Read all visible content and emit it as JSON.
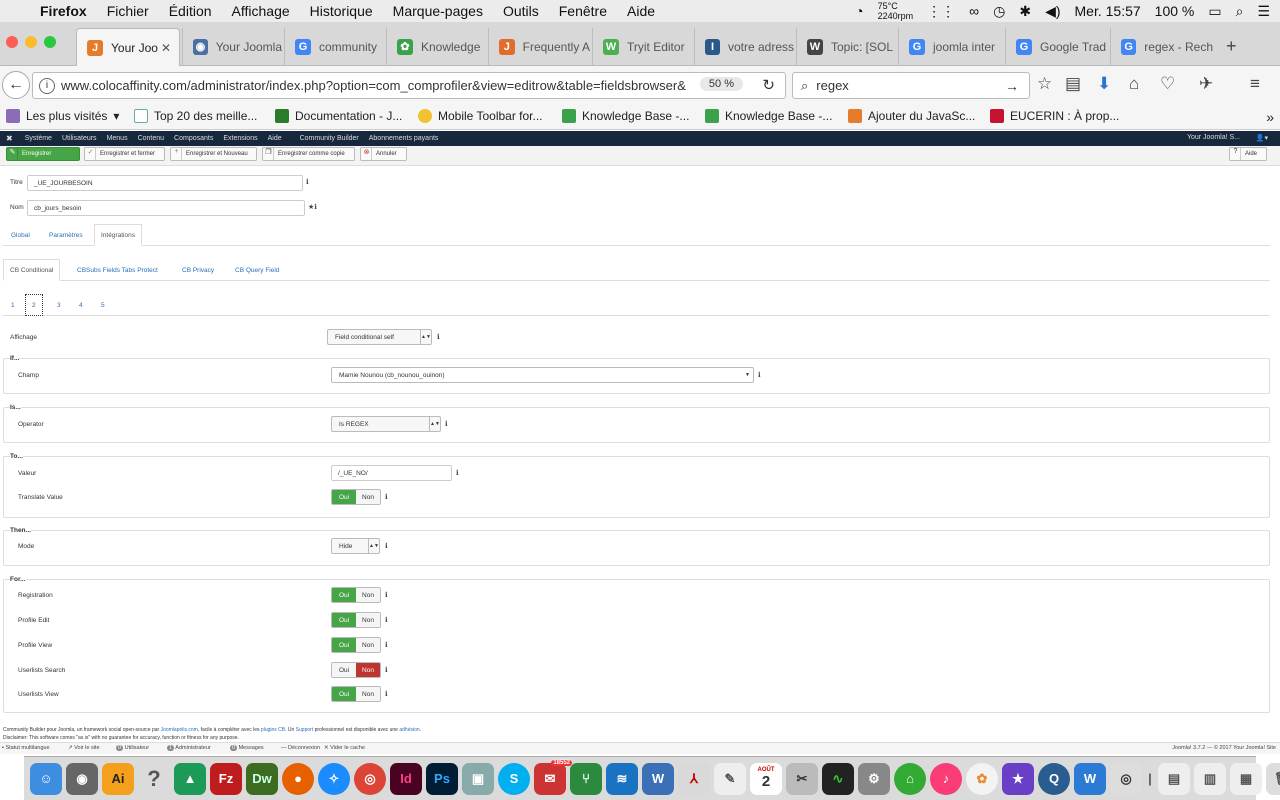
{
  "macbar": {
    "app": "Firefox",
    "menus": [
      "Fichier",
      "Édition",
      "Affichage",
      "Historique",
      "Marque-pages",
      "Outils",
      "Fenêtre",
      "Aide"
    ],
    "temp": "75°C",
    "rpm": "2240rpm",
    "clock": "Mer. 15:57",
    "battery": "100 %"
  },
  "tabs": [
    {
      "label": "Your Joo",
      "color": "#e57c2c",
      "glyph": "J"
    },
    {
      "label": "Your Joomla",
      "color": "#4a6fa5",
      "glyph": "◉"
    },
    {
      "label": "community",
      "color": "#4285f4",
      "glyph": "G"
    },
    {
      "label": "Knowledge",
      "color": "#3aa24a",
      "glyph": "✿"
    },
    {
      "label": "Frequently A",
      "color": "#e06d2c",
      "glyph": "J"
    },
    {
      "label": "Tryit Editor",
      "color": "#4caf50",
      "glyph": "W"
    },
    {
      "label": "votre adress",
      "color": "#2b5a8a",
      "glyph": "I"
    },
    {
      "label": "Topic: [SOL",
      "color": "#444",
      "glyph": "W"
    },
    {
      "label": "joomla inter",
      "color": "#4285f4",
      "glyph": "G"
    },
    {
      "label": "Google Trad",
      "color": "#4285f4",
      "glyph": "G"
    },
    {
      "label": "regex - Rech",
      "color": "#4285f4",
      "glyph": "G"
    }
  ],
  "nav": {
    "url": "www.colocaffinity.com/administrator/index.php?option=com_comprofiler&view=editrow&table=fieldsbrowser&",
    "zoom": "50 %",
    "search": "regex"
  },
  "bookmarks": [
    "Les plus visités",
    "Top 20 des meille...",
    "Documentation - J...",
    "Mobile Toolbar for...",
    "Knowledge Base -...",
    "Knowledge Base -...",
    "Ajouter du JavaSc...",
    "EUCERIN : À prop..."
  ],
  "adminmenu": {
    "items": [
      "Système",
      "Utilisateurs",
      "Menus",
      "Contenu",
      "Composants",
      "Extensions",
      "Aide",
      "Community Builder",
      "Abonnements payants"
    ],
    "site": "Your Joomla! S..."
  },
  "toolbar": {
    "save": "Enregistrer",
    "save_close": "Enregistrer et fermer",
    "save_new": "Enregistrer et Nouveau",
    "save_copy": "Enregistrer comme copie",
    "cancel": "Annuler",
    "help": "Aide"
  },
  "form": {
    "title_label": "Titre",
    "title_value": "_UE_JOURBESOIN",
    "name_label": "Nom",
    "name_value": "cb_jours_besoin"
  },
  "tabs1": [
    "Global",
    "Paramètres",
    "Intégrations"
  ],
  "tabs2": [
    "CB Conditional",
    "CBSubs Fields Tabs Protect",
    "CB Privacy",
    "CB Query Field"
  ],
  "tabs3": [
    "1",
    "2",
    "3",
    "4",
    "5"
  ],
  "cond": {
    "affichage_label": "Affichage",
    "affichage_value": "Field conditional self",
    "if": "If...",
    "champ_label": "Champ",
    "champ_value": "Mamie Nounou (cb_nounou_ouinon)",
    "is": "Is...",
    "operator_label": "Operator",
    "operator_value": "Is REGEX",
    "to": "To...",
    "valeur_label": "Valeur",
    "valeur_value": "/_UE_NO/",
    "translate_label": "Translate Value",
    "then": "Then...",
    "mode_label": "Mode",
    "mode_value": "Hide",
    "for": "For...",
    "registration": "Registration",
    "profile_edit": "Profile Edit",
    "profile_view": "Profile View",
    "userlists_search": "Userlists Search",
    "userlists_view": "Userlists View",
    "oui": "Oui",
    "non": "Non"
  },
  "footer": {
    "line1a": "Community Builder pour Joomla, un framework social open-source par ",
    "link1": "Joomlapolis.com",
    "line1b": ", facile à compléter avec les ",
    "link2": "plugins CB",
    "line1c": ". Un ",
    "link3": "Support",
    "line1d": " professionnel est disponible avec une ",
    "link4": "adhésion",
    "line1e": ".",
    "line2": "Disclaimer: This software comes \"as is\" with no guarantee for accuracy, function or fitness for any purpose."
  },
  "status": {
    "items": [
      "Statut multilangue",
      "Voir le site",
      "Utilisateur",
      "Administrateur",
      "Messages",
      "Déconnexion",
      "Vider le cache"
    ],
    "counts": [
      "0",
      "1",
      "0"
    ],
    "version": "Joomla! 3.7.2  —  © 2017 Your Joomla! Site"
  },
  "dock": {
    "badge": "18552",
    "calendar_month": "AOÛT",
    "calendar_day": "2"
  }
}
